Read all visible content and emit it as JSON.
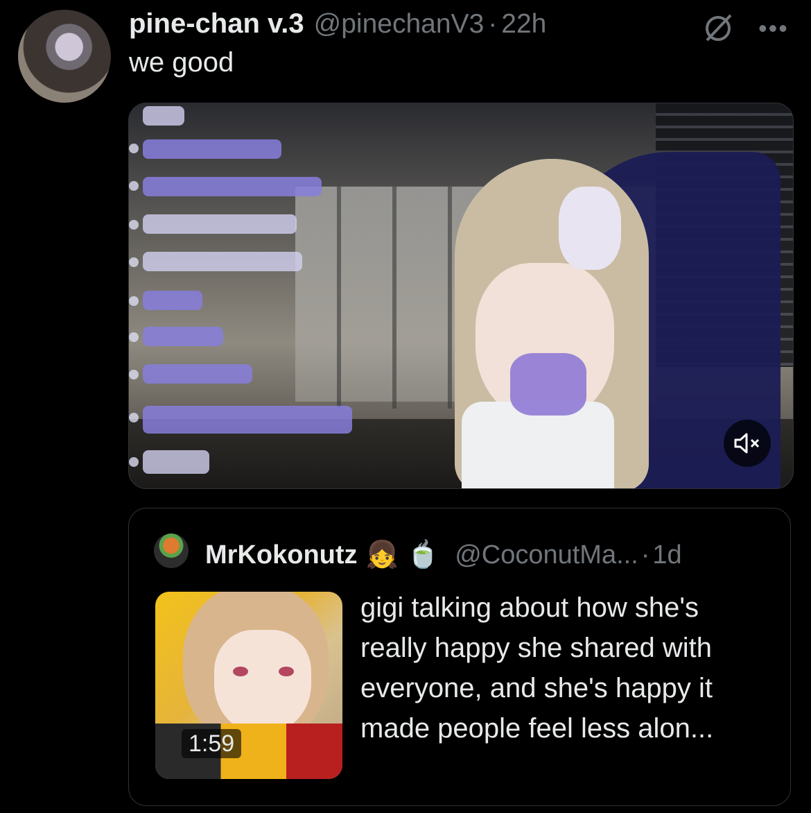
{
  "tweet": {
    "display_name": "pine-chan v.3",
    "handle": "@pinechanV3",
    "separator": "·",
    "time": "22h",
    "more_icon": "more-horizontal-icon",
    "grok_icon": "grok-icon",
    "text": "we good",
    "media": {
      "type": "video",
      "mute_icon": "volume-muted-icon"
    }
  },
  "quote": {
    "display_name": "MrKokonutz",
    "emoji_1": "👧",
    "emoji_2": "🍵",
    "handle": "@CoconutMa...",
    "separator": "·",
    "time": "1d",
    "thumbnail_duration": "1:59",
    "text": "gigi talking about how she's really happy she shared with everyone, and she's happy it made people feel less alon..."
  },
  "colors": {
    "background": "#000000",
    "primary_text": "#e7e9ea",
    "secondary_text": "#71767b",
    "border": "#2f3336"
  }
}
